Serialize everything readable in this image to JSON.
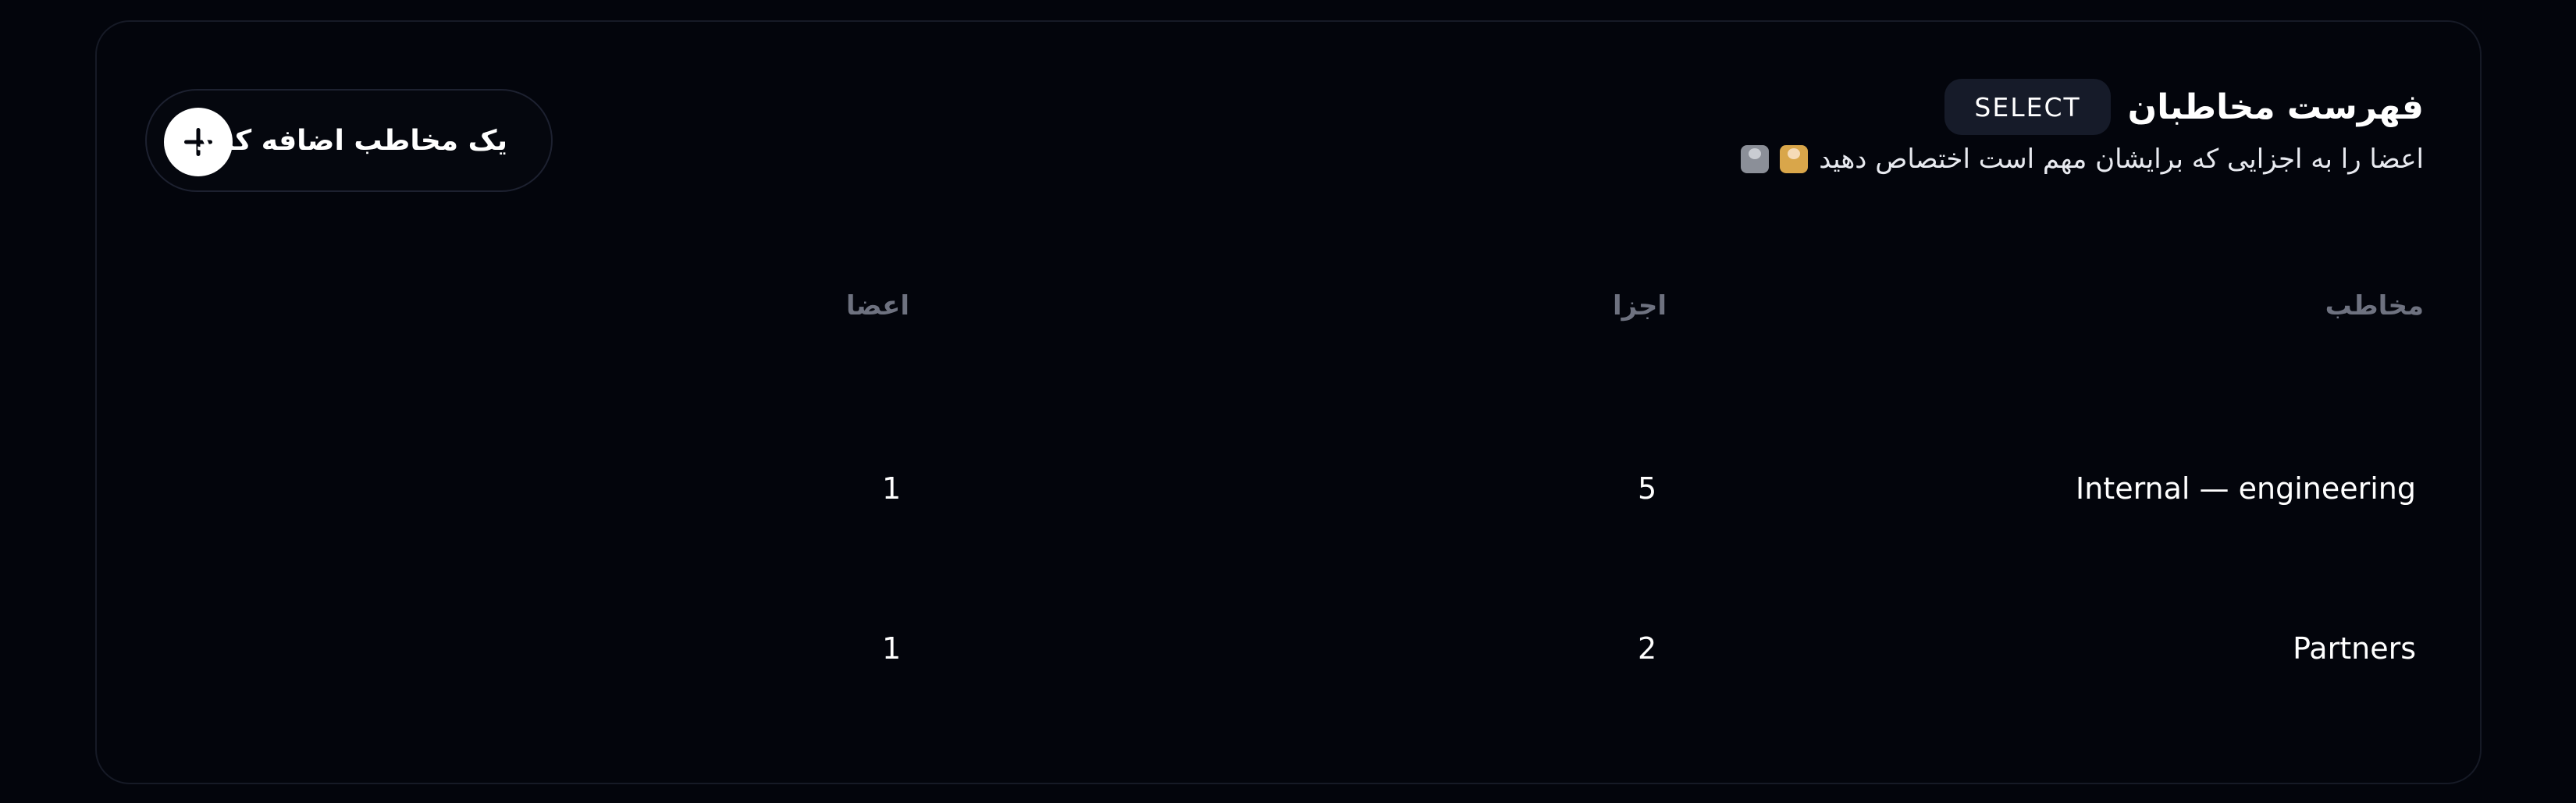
{
  "header": {
    "title": "فهرست مخاطبان",
    "badge": "SELECT",
    "subtitle": "اعضا را به اجزایی که برایشان مهم است اختصاص دهید",
    "subtitle_icons": [
      "person-office-worker-icon",
      "person-detective-icon"
    ]
  },
  "add_button": {
    "label": "یک مخاطب اضافه کنید",
    "icon": "plus-icon"
  },
  "table": {
    "columns": [
      "مخاطب",
      "اجزا",
      "اعضا"
    ],
    "rows": [
      {
        "contact": "Internal — engineering",
        "components": "5",
        "members": "1"
      },
      {
        "contact": "Partners",
        "components": "2",
        "members": "1"
      }
    ]
  },
  "colors": {
    "background": "#03050c",
    "card_border": "#161a26",
    "badge_bg": "#161b29",
    "header_text": "#6e7280",
    "text": "#ffffff"
  }
}
